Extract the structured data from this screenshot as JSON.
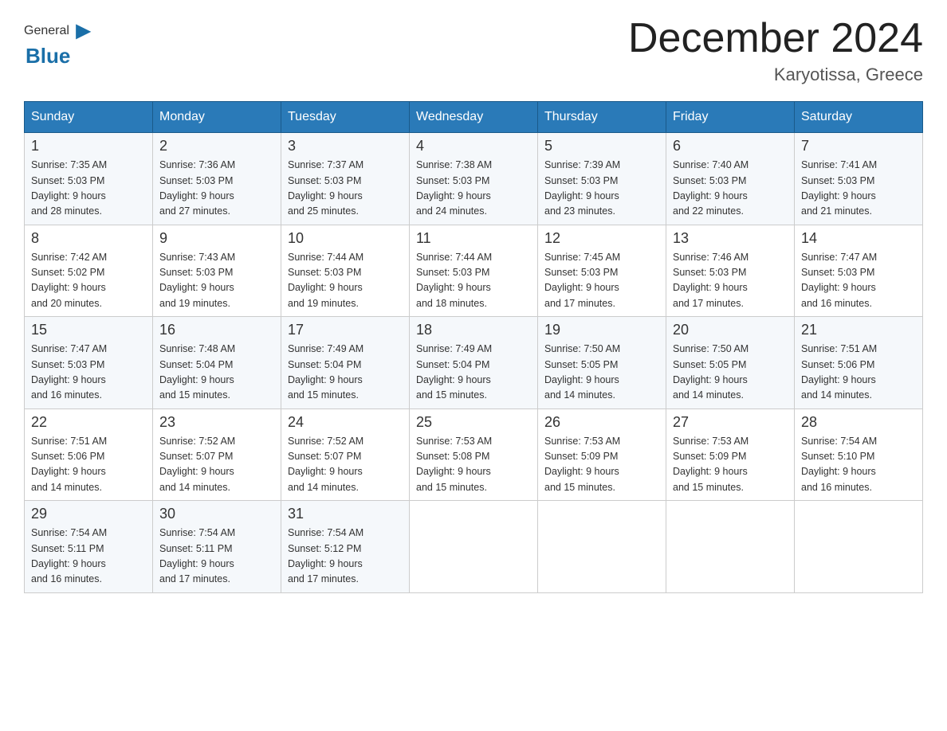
{
  "logo": {
    "general": "General",
    "blue": "Blue"
  },
  "title": "December 2024",
  "subtitle": "Karyotissa, Greece",
  "days_of_week": [
    "Sunday",
    "Monday",
    "Tuesday",
    "Wednesday",
    "Thursday",
    "Friday",
    "Saturday"
  ],
  "weeks": [
    [
      {
        "day": "1",
        "sunrise": "7:35 AM",
        "sunset": "5:03 PM",
        "daylight": "9 hours and 28 minutes."
      },
      {
        "day": "2",
        "sunrise": "7:36 AM",
        "sunset": "5:03 PM",
        "daylight": "9 hours and 27 minutes."
      },
      {
        "day": "3",
        "sunrise": "7:37 AM",
        "sunset": "5:03 PM",
        "daylight": "9 hours and 25 minutes."
      },
      {
        "day": "4",
        "sunrise": "7:38 AM",
        "sunset": "5:03 PM",
        "daylight": "9 hours and 24 minutes."
      },
      {
        "day": "5",
        "sunrise": "7:39 AM",
        "sunset": "5:03 PM",
        "daylight": "9 hours and 23 minutes."
      },
      {
        "day": "6",
        "sunrise": "7:40 AM",
        "sunset": "5:03 PM",
        "daylight": "9 hours and 22 minutes."
      },
      {
        "day": "7",
        "sunrise": "7:41 AM",
        "sunset": "5:03 PM",
        "daylight": "9 hours and 21 minutes."
      }
    ],
    [
      {
        "day": "8",
        "sunrise": "7:42 AM",
        "sunset": "5:02 PM",
        "daylight": "9 hours and 20 minutes."
      },
      {
        "day": "9",
        "sunrise": "7:43 AM",
        "sunset": "5:03 PM",
        "daylight": "9 hours and 19 minutes."
      },
      {
        "day": "10",
        "sunrise": "7:44 AM",
        "sunset": "5:03 PM",
        "daylight": "9 hours and 19 minutes."
      },
      {
        "day": "11",
        "sunrise": "7:44 AM",
        "sunset": "5:03 PM",
        "daylight": "9 hours and 18 minutes."
      },
      {
        "day": "12",
        "sunrise": "7:45 AM",
        "sunset": "5:03 PM",
        "daylight": "9 hours and 17 minutes."
      },
      {
        "day": "13",
        "sunrise": "7:46 AM",
        "sunset": "5:03 PM",
        "daylight": "9 hours and 17 minutes."
      },
      {
        "day": "14",
        "sunrise": "7:47 AM",
        "sunset": "5:03 PM",
        "daylight": "9 hours and 16 minutes."
      }
    ],
    [
      {
        "day": "15",
        "sunrise": "7:47 AM",
        "sunset": "5:03 PM",
        "daylight": "9 hours and 16 minutes."
      },
      {
        "day": "16",
        "sunrise": "7:48 AM",
        "sunset": "5:04 PM",
        "daylight": "9 hours and 15 minutes."
      },
      {
        "day": "17",
        "sunrise": "7:49 AM",
        "sunset": "5:04 PM",
        "daylight": "9 hours and 15 minutes."
      },
      {
        "day": "18",
        "sunrise": "7:49 AM",
        "sunset": "5:04 PM",
        "daylight": "9 hours and 15 minutes."
      },
      {
        "day": "19",
        "sunrise": "7:50 AM",
        "sunset": "5:05 PM",
        "daylight": "9 hours and 14 minutes."
      },
      {
        "day": "20",
        "sunrise": "7:50 AM",
        "sunset": "5:05 PM",
        "daylight": "9 hours and 14 minutes."
      },
      {
        "day": "21",
        "sunrise": "7:51 AM",
        "sunset": "5:06 PM",
        "daylight": "9 hours and 14 minutes."
      }
    ],
    [
      {
        "day": "22",
        "sunrise": "7:51 AM",
        "sunset": "5:06 PM",
        "daylight": "9 hours and 14 minutes."
      },
      {
        "day": "23",
        "sunrise": "7:52 AM",
        "sunset": "5:07 PM",
        "daylight": "9 hours and 14 minutes."
      },
      {
        "day": "24",
        "sunrise": "7:52 AM",
        "sunset": "5:07 PM",
        "daylight": "9 hours and 14 minutes."
      },
      {
        "day": "25",
        "sunrise": "7:53 AM",
        "sunset": "5:08 PM",
        "daylight": "9 hours and 15 minutes."
      },
      {
        "day": "26",
        "sunrise": "7:53 AM",
        "sunset": "5:09 PM",
        "daylight": "9 hours and 15 minutes."
      },
      {
        "day": "27",
        "sunrise": "7:53 AM",
        "sunset": "5:09 PM",
        "daylight": "9 hours and 15 minutes."
      },
      {
        "day": "28",
        "sunrise": "7:54 AM",
        "sunset": "5:10 PM",
        "daylight": "9 hours and 16 minutes."
      }
    ],
    [
      {
        "day": "29",
        "sunrise": "7:54 AM",
        "sunset": "5:11 PM",
        "daylight": "9 hours and 16 minutes."
      },
      {
        "day": "30",
        "sunrise": "7:54 AM",
        "sunset": "5:11 PM",
        "daylight": "9 hours and 17 minutes."
      },
      {
        "day": "31",
        "sunrise": "7:54 AM",
        "sunset": "5:12 PM",
        "daylight": "9 hours and 17 minutes."
      },
      null,
      null,
      null,
      null
    ]
  ],
  "labels": {
    "sunrise": "Sunrise:",
    "sunset": "Sunset:",
    "daylight": "Daylight:"
  }
}
